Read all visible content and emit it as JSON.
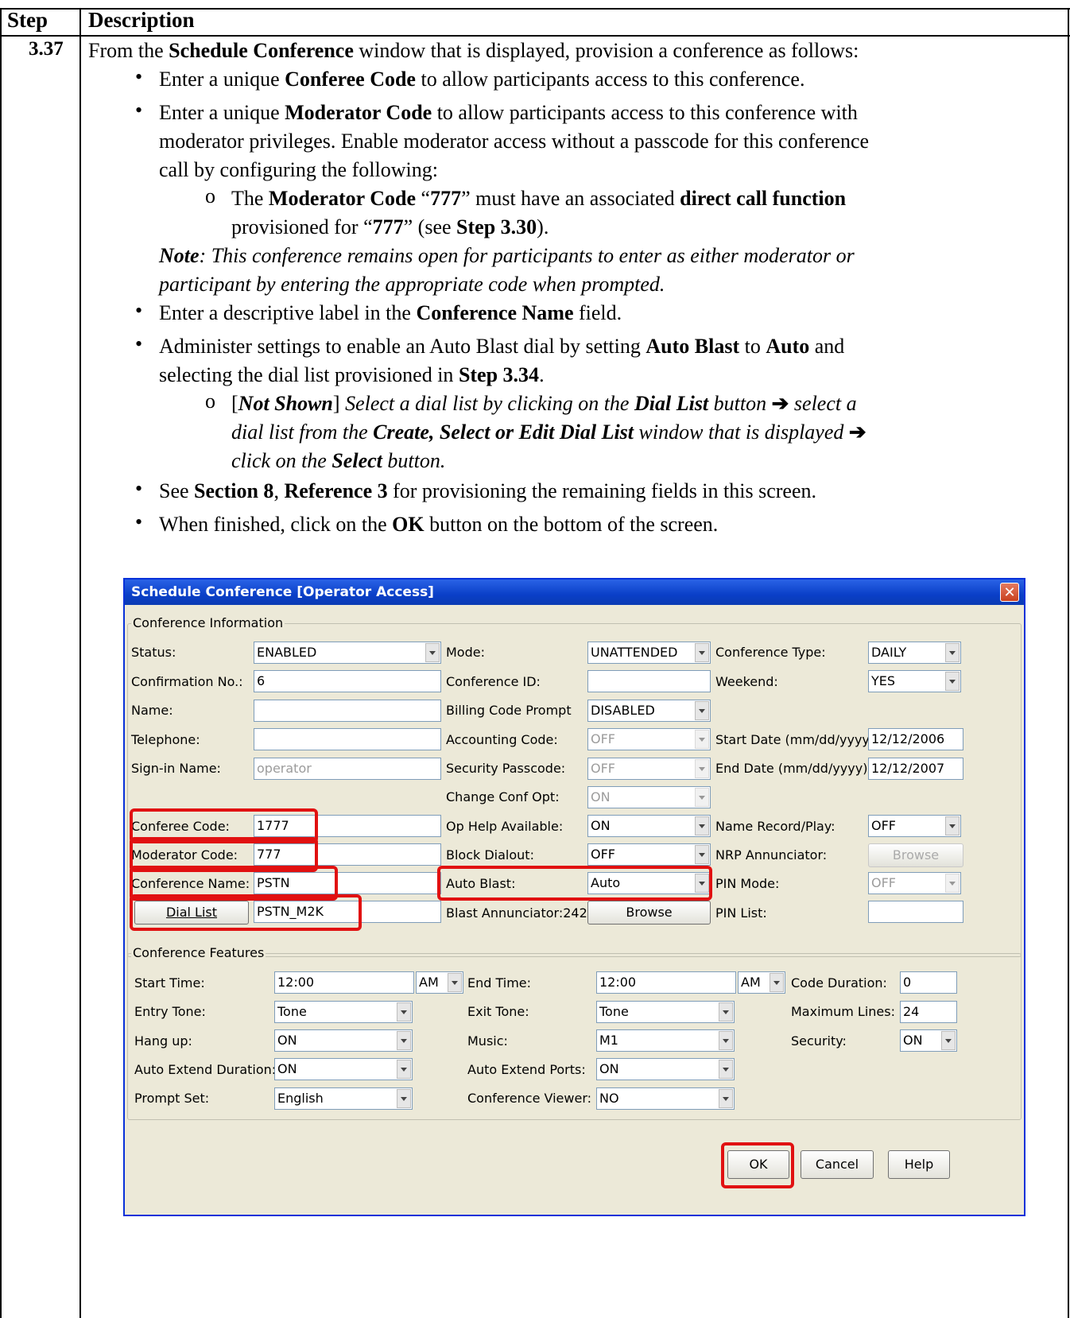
{
  "table": {
    "col_step": "Step",
    "col_description": "Description",
    "step_number": "3.37"
  },
  "text": {
    "intro_a": "From the ",
    "intro_b": "Schedule Conference",
    "intro_c": " window that is displayed, provision a conference as follows:",
    "b1_a": "Enter a unique ",
    "b1_b": "Conferee Code",
    "b1_c": " to allow participants access to this conference.",
    "b2_a": "Enter a unique ",
    "b2_b": "Moderator Code",
    "b2_c": " to allow participants access to this conference with",
    "b2_line2": "moderator privileges. Enable moderator access without a passcode for this conference",
    "b2_line3": "call by configuring the following:",
    "o1_a": "The ",
    "o1_b": "Moderator Code",
    "o1_c": " “",
    "o1_d": "777",
    "o1_e": "” must have an associated ",
    "o1_f": "direct call function",
    "o1_line2_a": "provisioned for “",
    "o1_line2_b": "777",
    "o1_line2_c": "” (see ",
    "o1_line2_d": "Step 3.30",
    "o1_line2_e": ").",
    "note_a": "Note",
    "note_b": ": This conference remains open for participants to enter as either moderator or",
    "note_line2": "participant by entering the appropriate code when prompted.",
    "b3_a": "Enter a descriptive label in the ",
    "b3_b": "Conference Name",
    "b3_c": " field.",
    "b4_a": "Administer settings to enable an Auto Blast dial by setting ",
    "b4_b": "Auto Blast",
    "b4_c": " to ",
    "b4_d": "Auto",
    "b4_e": " and",
    "b4_line2_a": "selecting the dial list provisioned in ",
    "b4_line2_b": "Step 3.34",
    "b4_line2_c": ".",
    "o2_a": "[",
    "o2_b": "Not Shown",
    "o2_c": "] ",
    "o2_d": "Select a dial list by clicking on the ",
    "o2_e": "Dial List",
    "o2_f": " button ",
    "o2_g": " select a",
    "o2_line2_a": "dial list from the ",
    "o2_line2_b": "Create, Select or Edit Dial List",
    "o2_line2_c": " window that is displayed ",
    "o2_line3_a": "click on the ",
    "o2_line3_b": "Select",
    "o2_line3_c": " button.",
    "arrow": "➔",
    "b5_a": "See ",
    "b5_b": "Section 8",
    "b5_c": ", ",
    "b5_d": "Reference 3",
    "b5_e": " for provisioning the remaining fields in this screen.",
    "b6_a": "When finished, click on the ",
    "b6_b": "OK",
    "b6_c": " button on the bottom of the screen.",
    "bullet_glyph": "•",
    "sub_glyph": "o"
  },
  "dialog": {
    "title": "Schedule Conference [Operator Access]",
    "close_glyph": "✕",
    "info_legend": "Conference Information",
    "features_legend": "Conference Features",
    "labels": {
      "status": "Status:",
      "confirmation": "Confirmation No.:",
      "name": "Name:",
      "telephone": "Telephone:",
      "signin": "Sign-in Name:",
      "conferee_code": "Conferee Code:",
      "moderator_code": "Moderator Code:",
      "conference_name": "Conference Name:",
      "mode": "Mode:",
      "conference_id": "Conference ID:",
      "billing": "Billing Code Prompt",
      "accounting": "Accounting Code:",
      "security_passcode": "Security Passcode:",
      "change_conf": "Change Conf Opt:",
      "op_help": "Op Help Available:",
      "block_dialout": "Block Dialout:",
      "auto_blast": "Auto Blast:",
      "blast_annunciator": "Blast Annunciator:242",
      "conference_type": "Conference Type:",
      "weekend": "Weekend:",
      "start_date": "Start Date (mm/dd/yyyy):",
      "end_date": "End Date (mm/dd/yyyy):",
      "name_record": "Name Record/Play:",
      "nrp": "NRP Annunciator:",
      "pin_mode": "PIN Mode:",
      "pin_list": "PIN List:",
      "start_time": "Start Time:",
      "entry_tone": "Entry Tone:",
      "hang_up": "Hang up:",
      "auto_extend_duration": "Auto Extend Duration:",
      "prompt_set": "Prompt Set:",
      "end_time": "End Time:",
      "exit_tone": "Exit Tone:",
      "music": "Music:",
      "auto_extend_ports": "Auto Extend Ports:",
      "conference_viewer": "Conference Viewer:",
      "code_duration": "Code Duration:",
      "maximum_lines": "Maximum Lines:",
      "security": "Security:"
    },
    "values": {
      "status": "ENABLED",
      "confirmation": "6",
      "name": "",
      "telephone": "",
      "signin": "operator",
      "conferee_code": "1777",
      "moderator_code": "777",
      "conference_name": "PSTN",
      "dial_list": "PSTN_M2K",
      "mode": "UNATTENDED",
      "conference_id": "",
      "billing": "DISABLED",
      "accounting": "OFF",
      "security_passcode": "OFF",
      "change_conf": "ON",
      "op_help": "ON",
      "block_dialout": "OFF",
      "auto_blast": "Auto",
      "conference_type": "DAILY",
      "weekend": "YES",
      "start_date": "12/12/2006",
      "end_date": "12/12/2007",
      "name_record": "OFF",
      "pin_mode": "OFF",
      "pin_list": "",
      "start_time": "12:00",
      "start_ampm": "AM",
      "entry_tone": "Tone",
      "hang_up": "ON",
      "auto_extend_duration": "ON",
      "prompt_set": "English",
      "end_time": "12:00",
      "end_ampm": "AM",
      "exit_tone": "Tone",
      "music": "M1",
      "auto_extend_ports": "ON",
      "conference_viewer": "NO",
      "code_duration": "0",
      "maximum_lines": "24",
      "security": "ON"
    },
    "buttons": {
      "dial_list": "Dial List",
      "browse_blast": "Browse",
      "browse_nrp": "Browse",
      "ok": "OK",
      "cancel": "Cancel",
      "help": "Help"
    },
    "highlight_color": "#e11111"
  }
}
